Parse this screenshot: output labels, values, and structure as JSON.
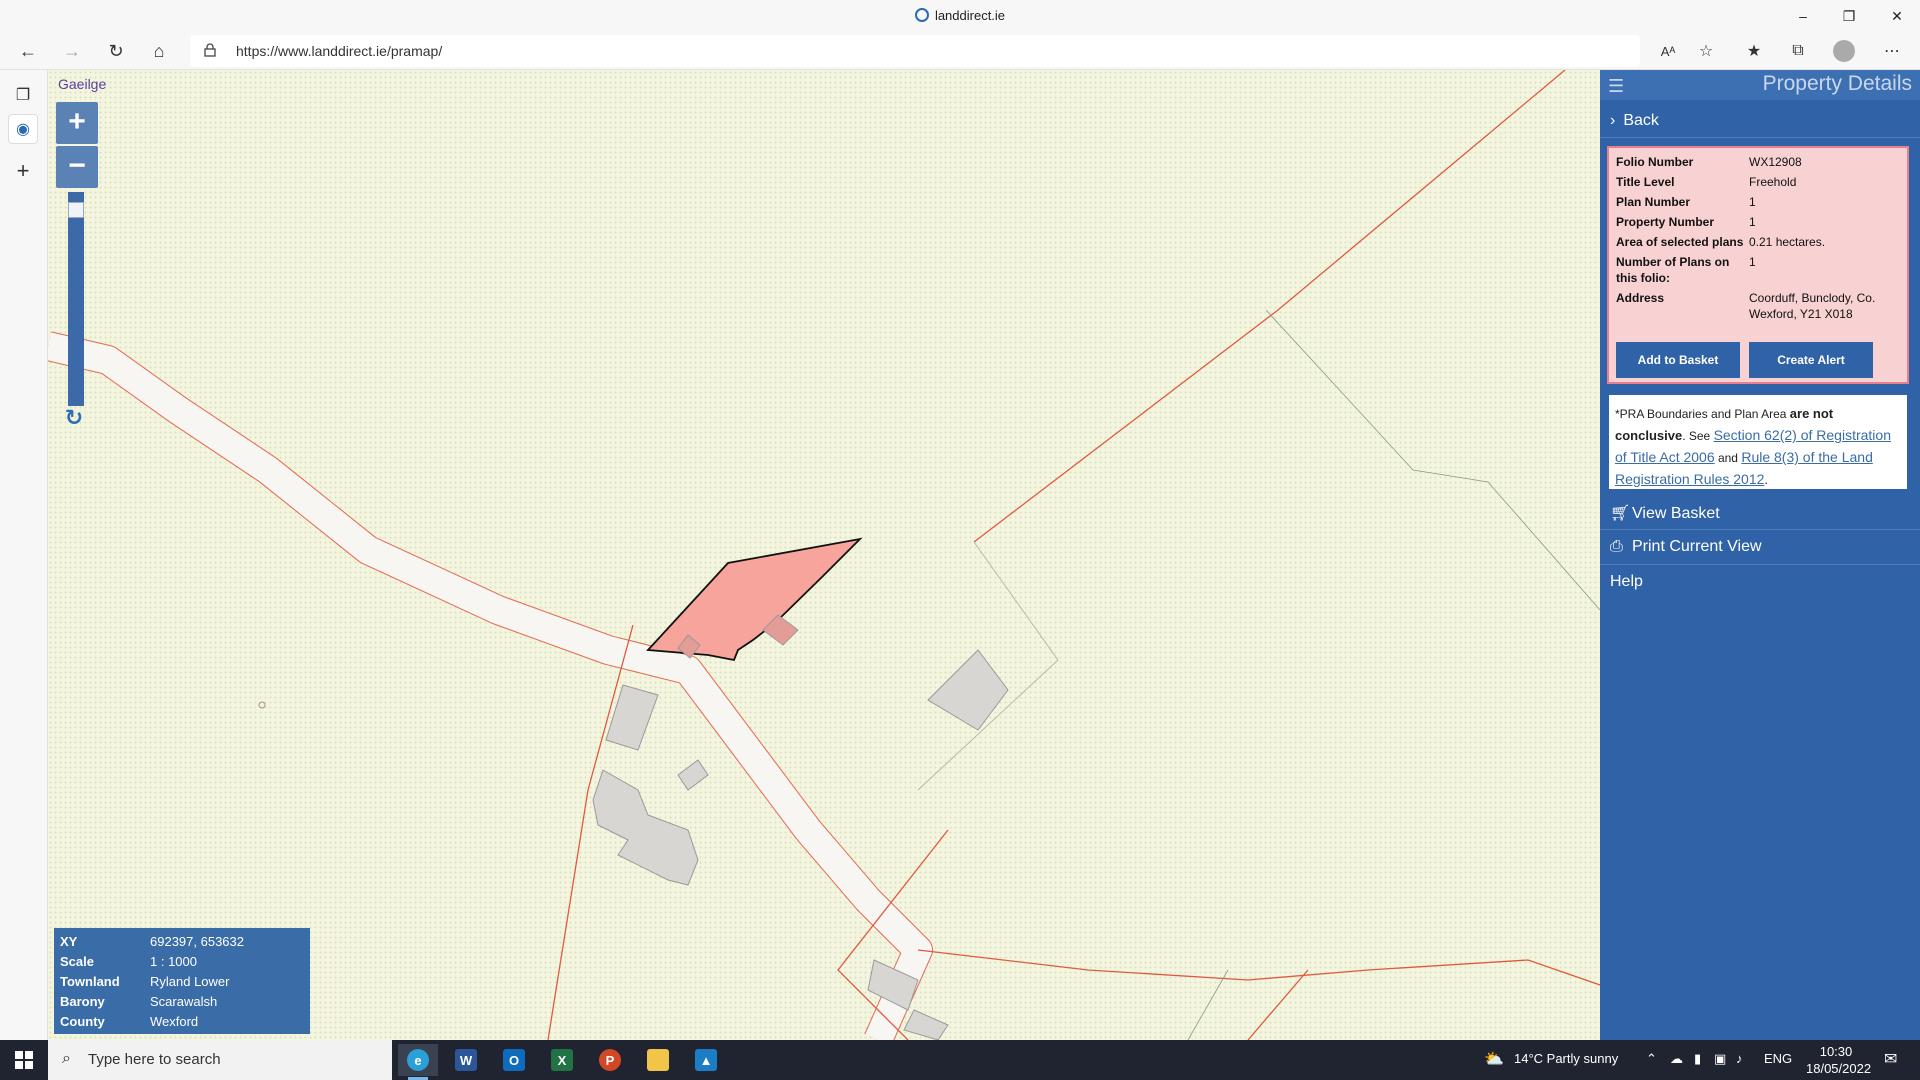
{
  "browser": {
    "window_title": "landdirect.ie",
    "url": "https://www.landdirect.ie/pramap/"
  },
  "map": {
    "language_link": "Gaeilge",
    "zoom_in_label": "+",
    "zoom_out_label": "−",
    "zoom_level": 0.05,
    "info": {
      "xy_label": "XY",
      "xy_value": "692397, 653632",
      "scale_label": "Scale",
      "scale_value": "1 : 1000",
      "townland_label": "Townland",
      "townland_value": "Ryland Lower",
      "barony_label": "Barony",
      "barony_value": "Scarawalsh",
      "county_label": "County",
      "county_value": "Wexford"
    }
  },
  "panel": {
    "title": "Property Details",
    "back_label": "Back",
    "details": [
      {
        "label": "Folio Number",
        "value": "WX12908"
      },
      {
        "label": "Title Level",
        "value": "Freehold"
      },
      {
        "label": "Plan Number",
        "value": "1"
      },
      {
        "label": "Property Number",
        "value": "1"
      },
      {
        "label": "Area of selected plans",
        "value": "0.21 hectares."
      },
      {
        "label": "Number of Plans on this folio:",
        "value": "1"
      },
      {
        "label": "Address",
        "value": "Coorduff, Bunclody, Co. Wexford, Y21 X018"
      }
    ],
    "add_to_basket": "Add to Basket",
    "create_alert": "Create Alert",
    "disclaimer": {
      "prefix": "*PRA Boundaries and Plan Area ",
      "bold": "are not conclusive",
      "see": ". See ",
      "link1": "Section 62(2) of Registration of Title Act 2006",
      "and": " and ",
      "link2": "Rule 8(3) of the Land Registration Rules 2012",
      "end": "."
    },
    "view_basket": "View Basket",
    "print_view": "Print Current View",
    "help": "Help"
  },
  "taskbar": {
    "search_placeholder": "Type here to search",
    "weather": "14°C  Partly sunny",
    "language": "ENG",
    "time": "10:30",
    "date": "18/05/2022"
  },
  "colors": {
    "panel_blue": "#2f62a6",
    "parcel_fill": "#f6a49c",
    "boundary_red": "#e0503a",
    "map_bg": "#f3f5df"
  }
}
